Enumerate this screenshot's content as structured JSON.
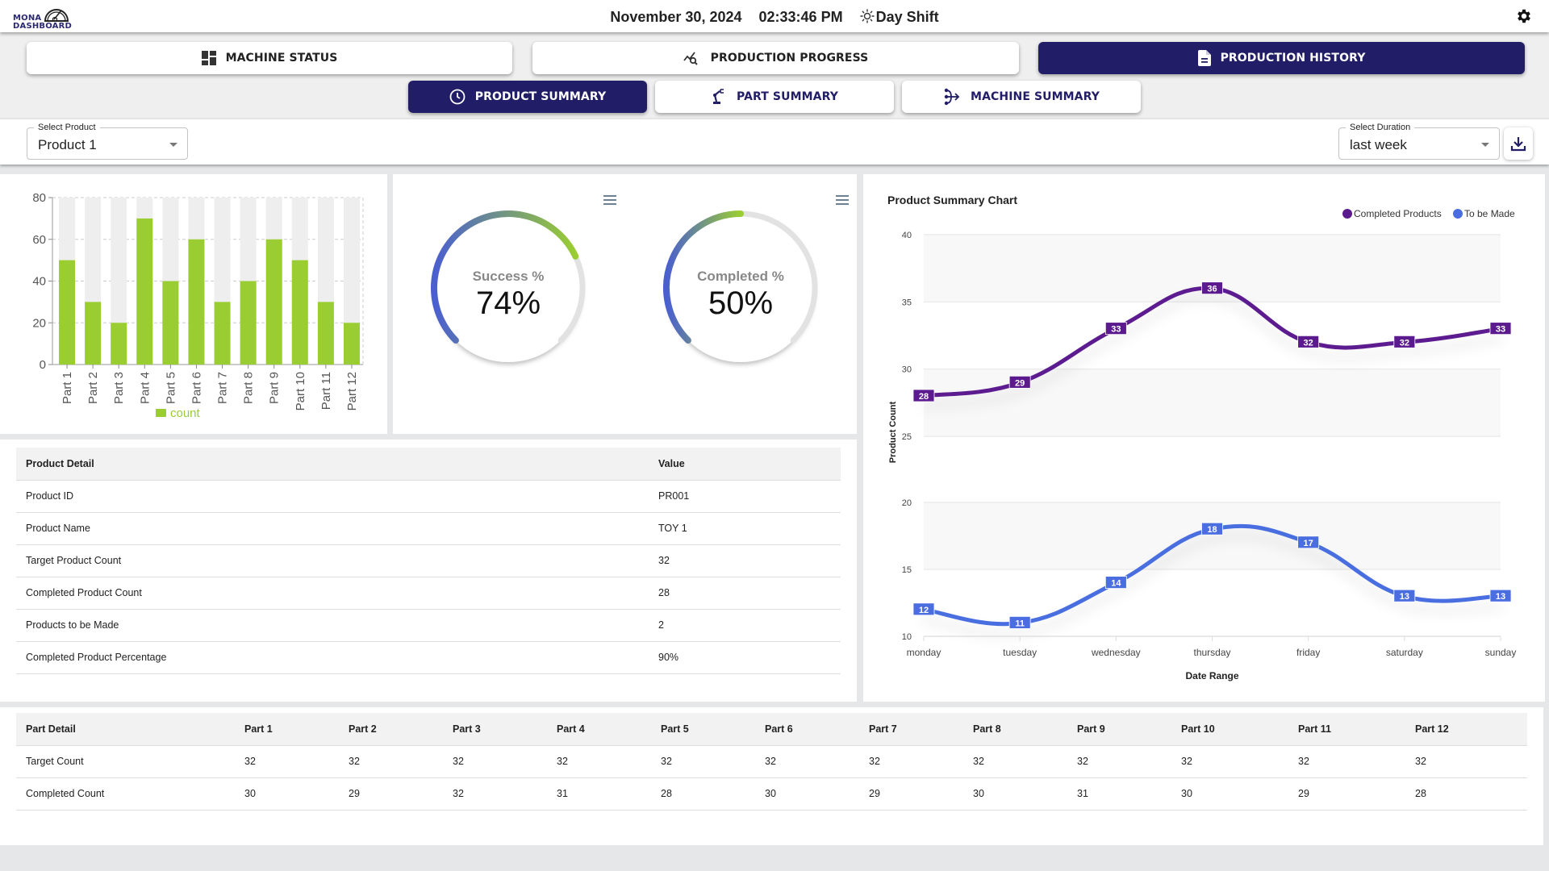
{
  "header": {
    "logo_line1": "MONA",
    "logo_line2": "DASHBOARD",
    "date": "November 30, 2024",
    "time": "02:33:46 PM",
    "shift": "Day Shift",
    "shift_icon": "sun-icon",
    "settings_icon": "gear-icon"
  },
  "nav": {
    "main_tabs": [
      {
        "label": "MACHINE STATUS",
        "icon": "dashboard-grid-icon",
        "active": false
      },
      {
        "label": "PRODUCTION PROGRESS",
        "icon": "chart-search-icon",
        "active": false
      },
      {
        "label": "PRODUCTION HISTORY",
        "icon": "document-icon",
        "active": true
      }
    ],
    "sub_tabs": [
      {
        "label": "PRODUCT SUMMARY",
        "icon": "clock-icon",
        "active": true
      },
      {
        "label": "PART SUMMARY",
        "icon": "robot-arm-icon",
        "active": false
      },
      {
        "label": "MACHINE SUMMARY",
        "icon": "flow-icon",
        "active": false
      }
    ]
  },
  "filters": {
    "product": {
      "label": "Select Product",
      "value": "Product 1"
    },
    "duration": {
      "label": "Select Duration",
      "value": "last week"
    },
    "download_icon": "download-icon"
  },
  "radials": [
    {
      "label": "Success %",
      "value_text": "74%",
      "value": 74
    },
    {
      "label": "Completed %",
      "value_text": "50%",
      "value": 50
    }
  ],
  "product_table": {
    "headers": [
      "Product Detail",
      "Value"
    ],
    "rows": [
      [
        "Product ID",
        "PR001"
      ],
      [
        "Product Name",
        "TOY 1"
      ],
      [
        "Target Product Count",
        "32"
      ],
      [
        "Completed Product Count",
        "28"
      ],
      [
        "Products to be Made",
        "2"
      ],
      [
        "Completed Product Percentage",
        "90%"
      ]
    ]
  },
  "part_table": {
    "headers": [
      "Part Detail",
      "Part 1",
      "Part 2",
      "Part 3",
      "Part 4",
      "Part 5",
      "Part 6",
      "Part 7",
      "Part 8",
      "Part 9",
      "Part 10",
      "Part 11",
      "Part 12"
    ],
    "rows": [
      [
        "Target Count",
        "32",
        "32",
        "32",
        "32",
        "32",
        "32",
        "32",
        "32",
        "32",
        "32",
        "32",
        "32"
      ],
      [
        "Completed Count",
        "30",
        "29",
        "32",
        "31",
        "28",
        "30",
        "29",
        "30",
        "31",
        "30",
        "29",
        "28"
      ]
    ]
  },
  "colors": {
    "brand": "#211d66",
    "bar_green": "#9acd32",
    "bar_track": "#eeeeee",
    "completed_line": "#5c1a8f",
    "to_be_made_line": "#4a6ee0"
  },
  "chart_data": [
    {
      "type": "bar",
      "title": "",
      "categories": [
        "Part 1",
        "Part 2",
        "Part 3",
        "Part 4",
        "Part 5",
        "Part 6",
        "Part 7",
        "Part 8",
        "Part 9",
        "Part 10",
        "Part 11",
        "Part 12"
      ],
      "values": [
        50,
        30,
        20,
        70,
        40,
        60,
        30,
        40,
        60,
        50,
        30,
        20
      ],
      "track_max": 80,
      "yticks": [
        0,
        20,
        40,
        60,
        80
      ],
      "ylim": [
        0,
        80
      ],
      "legend": [
        "count"
      ],
      "legend_position": "bottom",
      "grid": true,
      "xlabel": "",
      "ylabel": ""
    },
    {
      "type": "line",
      "title": "Product Summary Chart",
      "xlabel": "Date Range",
      "ylabel": "Product Count",
      "categories": [
        "monday",
        "tuesday",
        "wednesday",
        "thursday",
        "friday",
        "saturday",
        "sunday"
      ],
      "legend_position": "top-right",
      "series": [
        {
          "name": "Completed Products",
          "values": [
            28,
            29,
            33,
            36,
            32,
            32,
            33
          ],
          "ylim": [
            25,
            40
          ],
          "yticks": [
            25,
            30,
            35,
            40
          ]
        },
        {
          "name": "To be Made",
          "values": [
            12,
            11,
            14,
            18,
            17,
            13,
            13
          ],
          "ylim": [
            10,
            20
          ],
          "yticks": [
            10,
            15,
            20
          ]
        }
      ],
      "grid": true
    }
  ]
}
